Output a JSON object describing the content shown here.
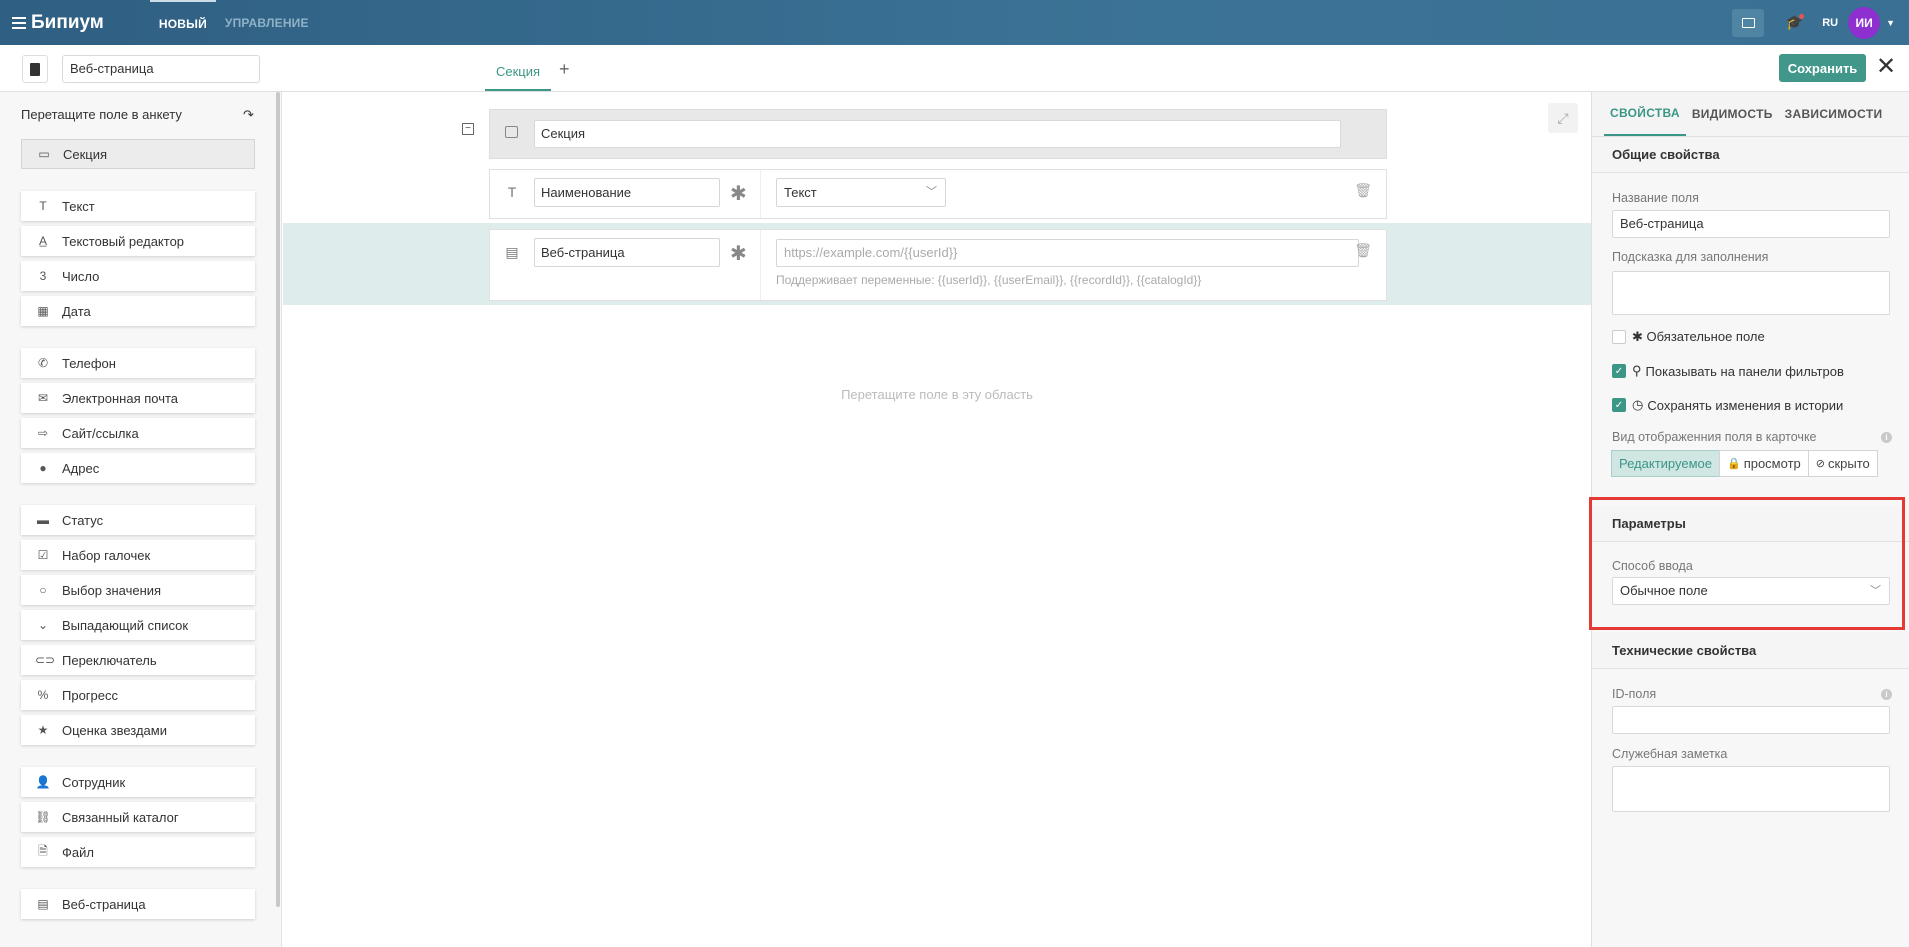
{
  "topbar": {
    "logo": "Бипиум",
    "nav": [
      "НОВЫЙ",
      "УПРАВЛЕНИЕ"
    ],
    "lang": "RU",
    "avatar": "ИИ"
  },
  "editor": {
    "form_name": "Веб-страница",
    "tab": "Секция",
    "save_label": "Сохранить"
  },
  "palette": {
    "header": "Перетащите поле в анкету",
    "section": "Секция",
    "items": [
      "Текст",
      "Текстовый редактор",
      "Число",
      "Дата",
      "Телефон",
      "Электронная почта",
      "Сайт/ссылка",
      "Адрес",
      "Статус",
      "Набор галочек",
      "Выбор значения",
      "Выпадающий список",
      "Переключатель",
      "Прогресс",
      "Оценка звездами",
      "Сотрудник",
      "Связанный каталог",
      "Файл",
      "Веб-страница"
    ]
  },
  "canvas": {
    "section_name": "Секция",
    "field1_name": "Наименование",
    "field1_type": "Текст",
    "field2_name": "Веб-страница",
    "field2_placeholder": "https://example.com/{{userId}}",
    "field2_hint": "Поддерживает переменные: {{userId}}, {{userEmail}}, {{recordId}}, {{catalogId}}",
    "drop_hint": "Перетащите поле в эту область"
  },
  "props": {
    "tabs": [
      "СВОЙСТВА",
      "ВИДИМОСТЬ",
      "ЗАВИСИМОСТИ"
    ],
    "general_title": "Общие свойства",
    "field_name_label": "Название поля",
    "field_name_value": "Веб-страница",
    "hint_label": "Подсказка для заполнения",
    "required_label": "✱ Обязательное поле",
    "filter_label": "Показывать на панели фильтров",
    "history_label": "Сохранять изменения в истории",
    "display_label": "Вид отображенния поля в карточке",
    "display_options": [
      "Редактируемое",
      "просмотр",
      "скрыто"
    ],
    "params_title": "Параметры",
    "input_mode_label": "Способ ввода",
    "input_mode_value": "Обычное поле",
    "tech_title": "Технические свойства",
    "id_label": "ID-поля",
    "note_label": "Служебная заметка"
  }
}
